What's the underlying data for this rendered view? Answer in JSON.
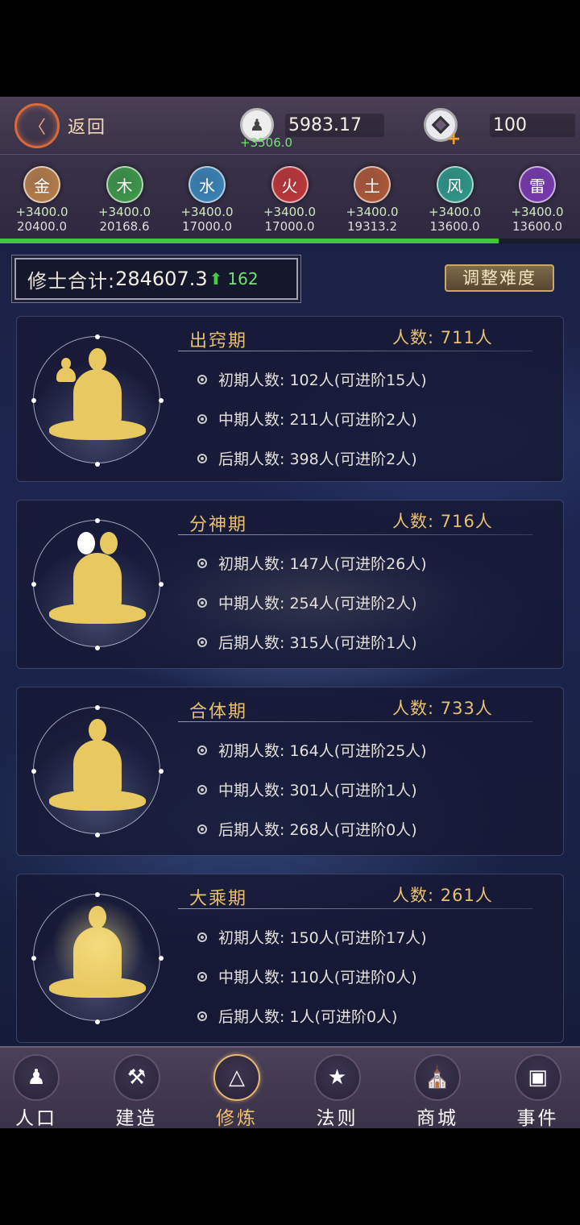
{
  "topbar": {
    "back_label": "返回",
    "population": "5983.17",
    "population_delta": "+3506.0",
    "gems": "100"
  },
  "elements": [
    {
      "name": "金",
      "delta": "+3400.0",
      "total": "20400.0",
      "color": "#b8804a"
    },
    {
      "name": "木",
      "delta": "+3400.0",
      "total": "20168.6",
      "color": "#3e9a4a"
    },
    {
      "name": "水",
      "delta": "+3400.0",
      "total": "17000.0",
      "color": "#3a86b8"
    },
    {
      "name": "火",
      "delta": "+3400.0",
      "total": "17000.0",
      "color": "#c03838"
    },
    {
      "name": "土",
      "delta": "+3400.0",
      "total": "19313.2",
      "color": "#b05a38"
    },
    {
      "name": "风",
      "delta": "+3400.0",
      "total": "13600.0",
      "color": "#2e9a8a"
    },
    {
      "name": "雷",
      "delta": "+3400.0",
      "total": "13600.0",
      "color": "#7a3ab0"
    }
  ],
  "progress": 0.86,
  "total": {
    "label": "修士合计:",
    "value": "284607.3",
    "increase": "162"
  },
  "adjust_label": "调整难度",
  "stages": [
    {
      "title": "出窍期",
      "count": "人数: 711人",
      "rows": [
        "初期人数: 102人(可进阶15人)",
        "中期人数: 211人(可进阶2人)",
        "后期人数: 398人(可进阶2人)"
      ]
    },
    {
      "title": "分神期",
      "count": "人数: 716人",
      "rows": [
        "初期人数: 147人(可进阶26人)",
        "中期人数: 254人(可进阶2人)",
        "后期人数: 315人(可进阶1人)"
      ]
    },
    {
      "title": "合体期",
      "count": "人数: 733人",
      "rows": [
        "初期人数: 164人(可进阶25人)",
        "中期人数: 301人(可进阶1人)",
        "后期人数: 268人(可进阶0人)"
      ]
    },
    {
      "title": "大乘期",
      "count": "人数: 261人",
      "rows": [
        "初期人数: 150人(可进阶17人)",
        "中期人数: 110人(可进阶0人)",
        "后期人数: 1人(可进阶0人)"
      ]
    }
  ],
  "nav": [
    {
      "label": "人口",
      "icon": "people-icon"
    },
    {
      "label": "建造",
      "icon": "tools-icon"
    },
    {
      "label": "修炼",
      "icon": "meditate-icon",
      "active": true
    },
    {
      "label": "法则",
      "icon": "rules-icon"
    },
    {
      "label": "商城",
      "icon": "shop-icon"
    },
    {
      "label": "事件",
      "icon": "event-book-icon"
    }
  ]
}
